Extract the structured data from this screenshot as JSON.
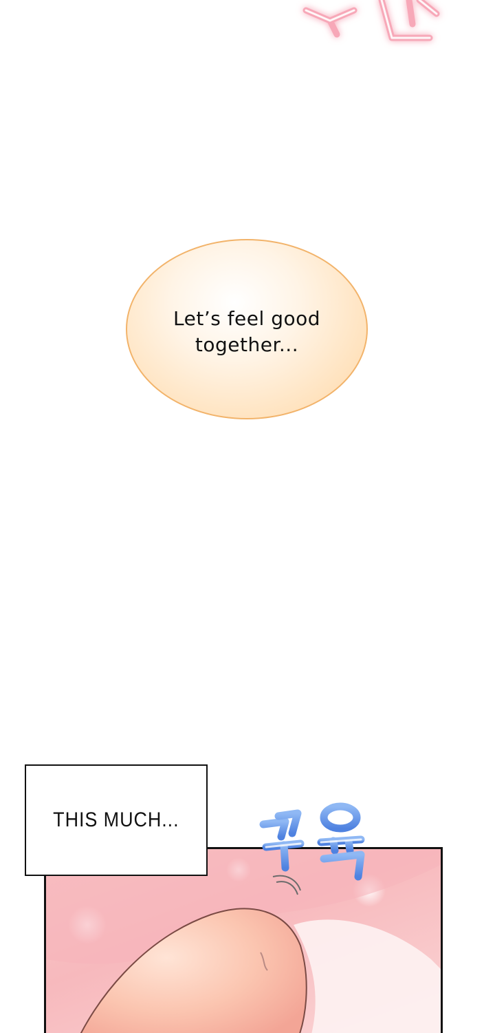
{
  "bubble": {
    "line1": "Let’s feel good",
    "line2": "together..."
  },
  "narration": {
    "text": "THIS MUCH..."
  },
  "colors": {
    "bubble_fill": "#ffe2bd",
    "bubble_border": "#f2b36a",
    "sfx_pink": "#f7a8b8",
    "sfx_blue": "#6a9bea",
    "panel_pink": "#f7b9bd"
  },
  "icons": {
    "top_sfx": "pink-glow-sound-effect",
    "blue_sfx": "blue-sound-effect"
  }
}
